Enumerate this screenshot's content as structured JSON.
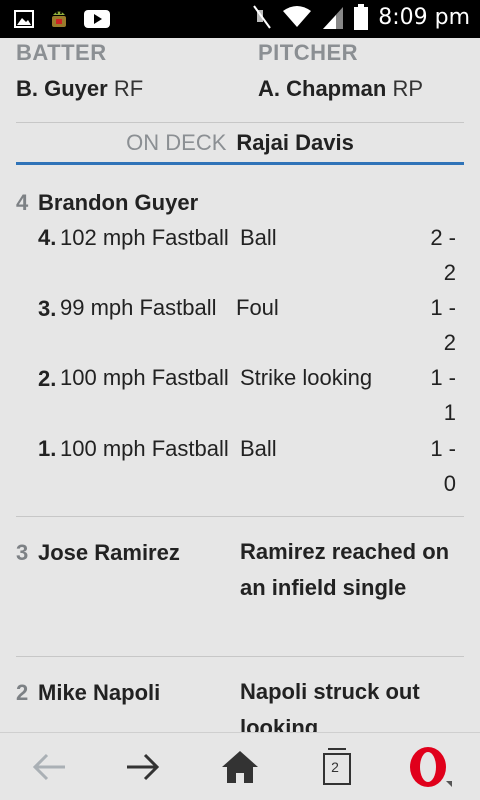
{
  "status_bar": {
    "time": "8:09 pm",
    "icons": [
      "image-icon",
      "android-icon",
      "youtube-icon",
      "mute-icon",
      "wifi-icon",
      "signal-icon",
      "battery-icon"
    ]
  },
  "header": {
    "batter_label": "BATTER",
    "batter_name": "B. Guyer",
    "batter_pos": "RF",
    "pitcher_label": "PITCHER",
    "pitcher_name": "A. Chapman",
    "pitcher_pos": "RP"
  },
  "on_deck": {
    "label": "ON DECK",
    "name": "Rajai Davis"
  },
  "at_bats": [
    {
      "num": "4",
      "batter": "Brandon Guyer",
      "pitches": [
        {
          "num": "4.",
          "desc": "102 mph Fastball",
          "result": "Ball",
          "count": "2 - 2"
        },
        {
          "num": "3.",
          "desc": "99 mph Fastball",
          "result": "Foul",
          "count": "1 - 2"
        },
        {
          "num": "2.",
          "desc": "100 mph Fastball",
          "result": "Strike looking",
          "count": "1 - 1"
        },
        {
          "num": "1.",
          "desc": "100 mph Fastball",
          "result": "Ball",
          "count": "1 - 0"
        }
      ]
    },
    {
      "num": "3",
      "batter": "Jose Ramirez",
      "result": "Ramirez reached on an infield single"
    },
    {
      "num": "2",
      "batter": "Mike Napoli",
      "result": "Napoli struck out looking"
    }
  ],
  "nav": {
    "tab_count": "2",
    "buttons": [
      "back-arrow-icon",
      "forward-arrow-icon",
      "home-icon",
      "tabs-icon",
      "opera-menu-icon"
    ]
  },
  "colors": {
    "accent_blue": "#2f73b8",
    "opera_red": "#e0001b",
    "muted_gray": "#8b8f93"
  }
}
